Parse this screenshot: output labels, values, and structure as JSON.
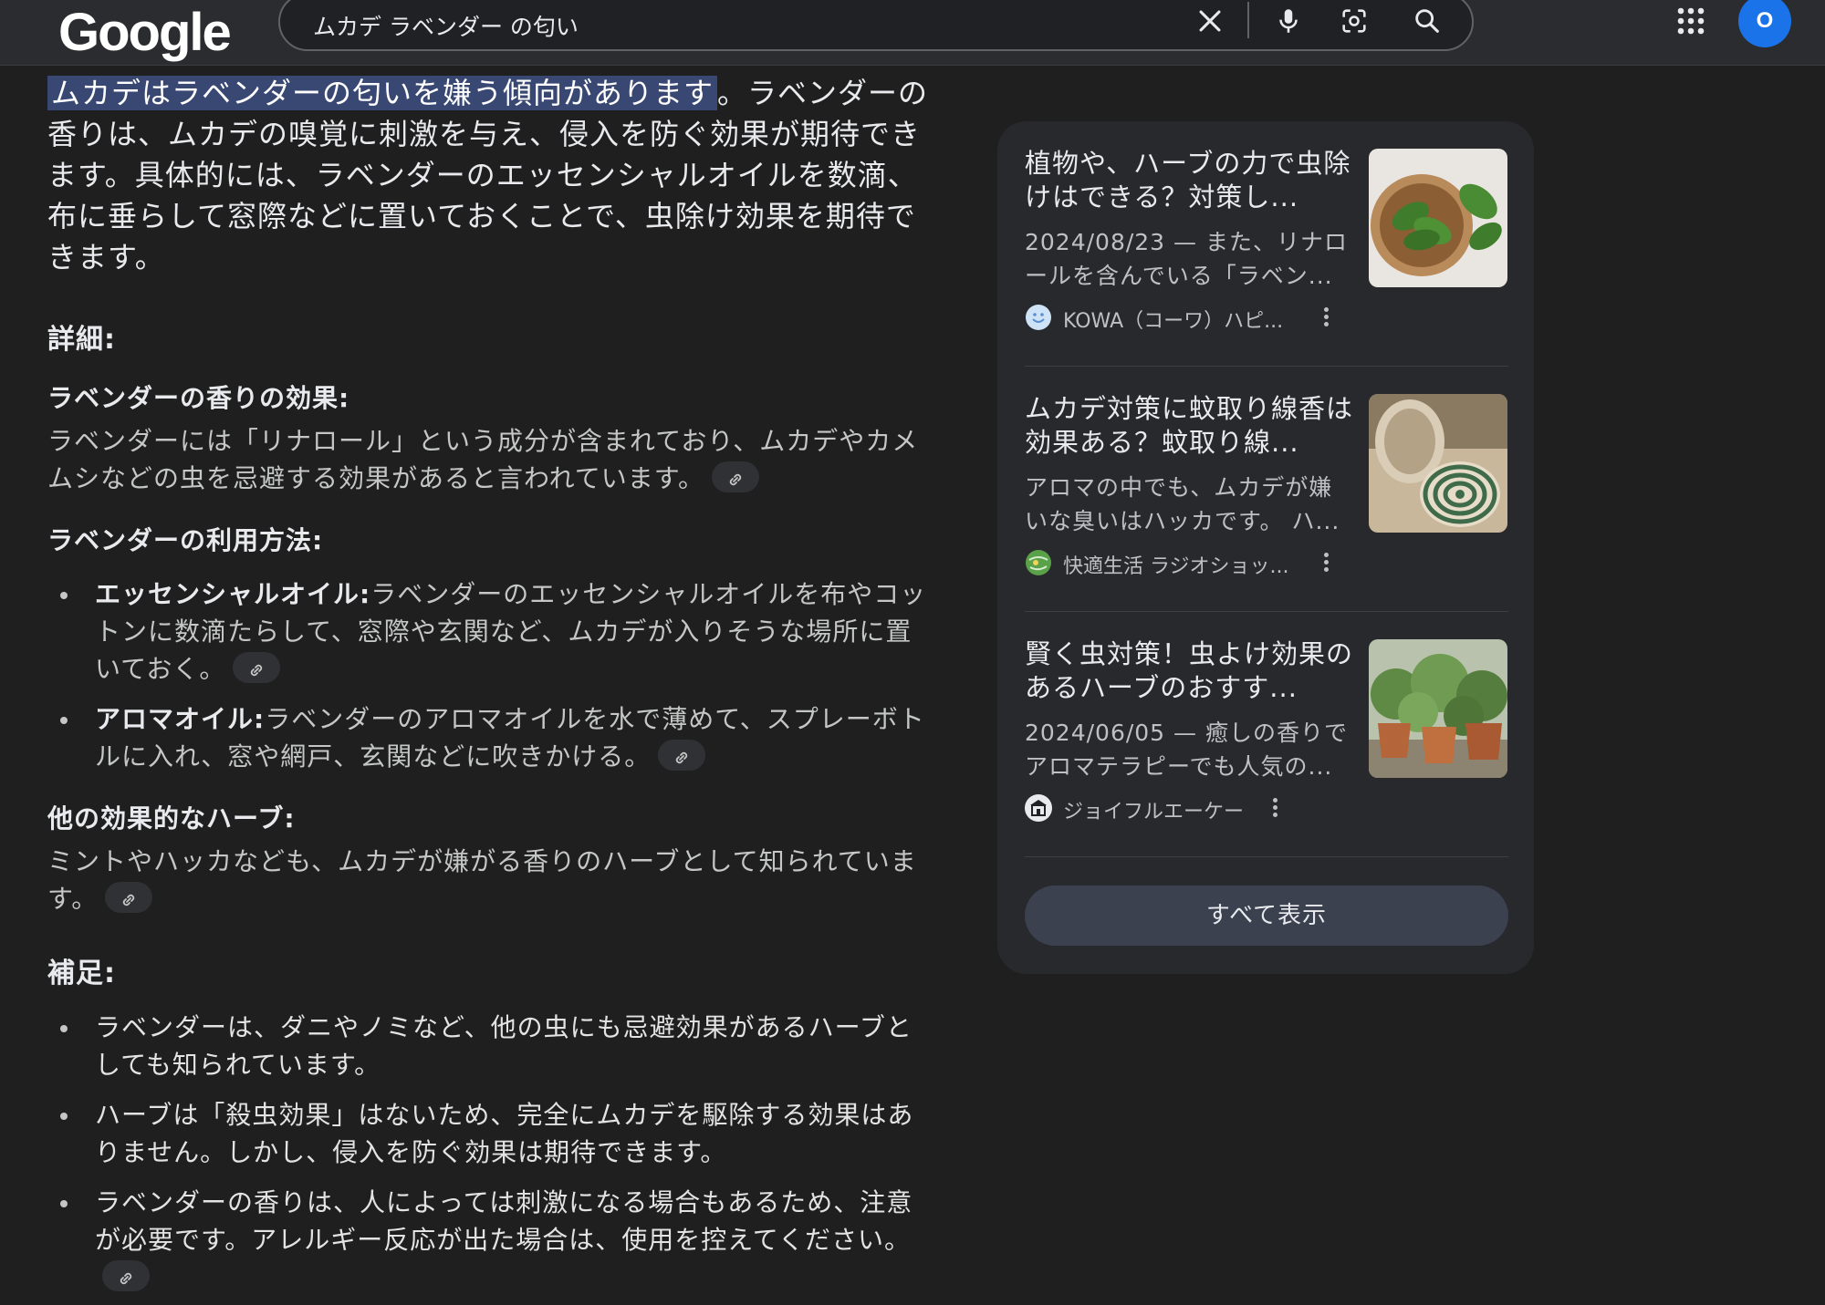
{
  "header": {
    "logo": "Google",
    "search_query": "ムカデ ラベンダー の匂い",
    "avatar_letter": "O"
  },
  "answer": {
    "highlight": "ムカデはラベンダーの匂いを嫌う傾向があります",
    "lead_rest": "。ラベンダーの香りは、ムカデの嗅覚に刺激を与え、侵入を防ぐ効果が期待できます。具体的には、ラベンダーのエッセンシャルオイルを数滴、布に垂らして窓際などに置いておくことで、虫除け効果を期待できます。",
    "details_heading": "詳細:",
    "effect_heading": "ラベンダーの香りの効果:",
    "effect_text": "ラベンダーには「リナロール」という成分が含まれており、ムカデやカメムシなどの虫を忌避する効果があると言われています。",
    "usage_heading": "ラベンダーの利用方法:",
    "usage_items": [
      {
        "term": "エッセンシャルオイル:",
        "text": "ラベンダーのエッセンシャルオイルを布やコットンに数滴たらして、窓際や玄関など、ムカデが入りそうな場所に置いておく。"
      },
      {
        "term": "アロマオイル:",
        "text": "ラベンダーのアロマオイルを水で薄めて、スプレーボトルに入れ、窓や網戸、玄関などに吹きかける。"
      }
    ],
    "herbs_heading": "他の効果的なハーブ:",
    "herbs_text": "ミントやハッカなども、ムカデが嫌がる香りのハーブとして知られています。",
    "notes_heading": "補足:",
    "notes_items": [
      "ラベンダーは、ダニやノミなど、他の虫にも忌避効果があるハーブとしても知られています。",
      "ハーブは「殺虫効果」はないため、完全にムカデを駆除する効果はありません。しかし、侵入を防ぐ効果は期待できます。",
      "ラベンダーの香りは、人によっては刺激になる場合もあるため、注意が必要です。アレルギー反応が出た場合は、使用を控えてください。"
    ]
  },
  "sources": {
    "cards": [
      {
        "title": "植物や、ハーブの力で虫除けはできる？対策し...",
        "snippet": "2024/08/23 — また、リナロールを含んでいる「ラベン...",
        "source": "KOWA（コーワ）ハピ...",
        "icon": "smiley-icon",
        "thumb": "basil-leaves"
      },
      {
        "title": "ムカデ対策に蚊取り線香は効果ある？蚊取り線...",
        "snippet": "アロマの中でも、ムカデが嫌いな臭いはハッカです。 ハ...",
        "source": "快適生活 ラジオショッ...",
        "icon": "globe-icon",
        "thumb": "mosquito-coil"
      },
      {
        "title": "賢く虫対策！虫よけ効果のあるハーブのおすす...",
        "snippet": "2024/06/05 — 癒しの香りでアロマテラピーでも人気の...",
        "source": "ジョイフルエーケー",
        "icon": "store-icon",
        "thumb": "potted-herbs"
      }
    ],
    "show_all_label": "すべて表示"
  },
  "colors": {
    "background": "#1f1f1f",
    "highlight": "#394773",
    "avatar": "#1a73e8"
  }
}
